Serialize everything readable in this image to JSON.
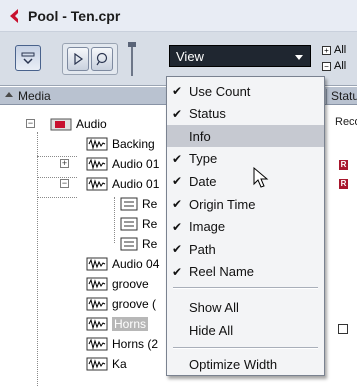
{
  "window": {
    "title": "Pool - Ten.cpr"
  },
  "toolbar": {
    "view_label": "View",
    "option_1": "All",
    "option_2": "All"
  },
  "columns": {
    "media": "Media",
    "status": "Statu"
  },
  "tree": {
    "root_label": "Audio",
    "rows": [
      {
        "label": "Backing"
      },
      {
        "label": "Audio 01"
      },
      {
        "label": "Audio 01"
      },
      {
        "label": "Re"
      },
      {
        "label": "Re"
      },
      {
        "label": "Re"
      },
      {
        "label": "Audio 04"
      },
      {
        "label": "groove"
      },
      {
        "label": "groove ("
      },
      {
        "label": "Horns"
      },
      {
        "label": "Horns (2"
      },
      {
        "label": "Ka"
      }
    ],
    "status_text": "Reco",
    "status_mark": "R"
  },
  "menu": {
    "items": [
      {
        "label": "Use Count",
        "checked": "✔"
      },
      {
        "label": "Status",
        "checked": "✔"
      },
      {
        "label": "Info",
        "checked": ""
      },
      {
        "label": "Type",
        "checked": "✔"
      },
      {
        "label": "Date",
        "checked": "✔"
      },
      {
        "label": "Origin Time",
        "checked": "✔"
      },
      {
        "label": "Image",
        "checked": "✔"
      },
      {
        "label": "Path",
        "checked": "✔"
      },
      {
        "label": "Reel Name",
        "checked": "✔"
      }
    ],
    "show_all": "Show All",
    "hide_all": "Hide All",
    "optimize_width": "Optimize Width"
  },
  "colors": {
    "view_select_bg": "#1f2630",
    "highlight": "#c6c9d1",
    "record_red": "#a8172d",
    "title_logo_red": "#c8102e"
  },
  "icons": {
    "title_logo": "steinberg-logo-icon",
    "cursor": "mouse-pointer-icon"
  }
}
